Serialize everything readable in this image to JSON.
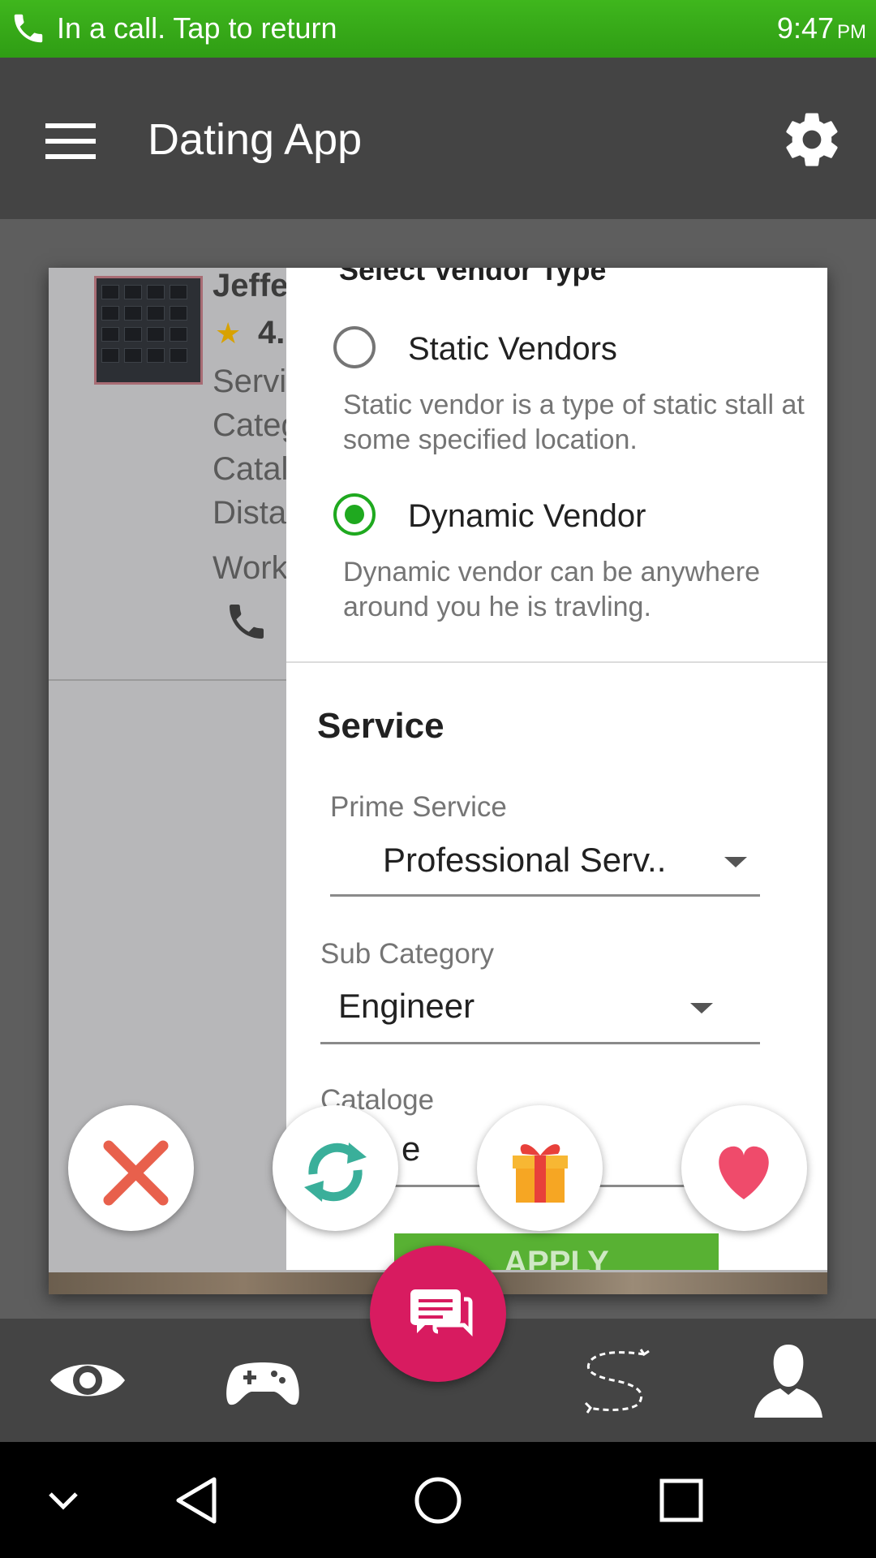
{
  "status_bar": {
    "call_text": "In a call. Tap to return",
    "time": "9:47",
    "ampm": "PM",
    "icons": [
      "phone-icon"
    ]
  },
  "app_bar": {
    "title": "Dating App",
    "icons": [
      "menu-icon",
      "gear-icon"
    ]
  },
  "card": {
    "name": "Jeffe",
    "rating": "4.",
    "labels": [
      "Servi",
      "Categ",
      "Catal",
      "Dista",
      "Work"
    ],
    "icons": [
      "star-icon",
      "phone-icon"
    ]
  },
  "dialog": {
    "section_title": "Select Vendor Type",
    "options": [
      {
        "label": "Static Vendors",
        "description": "Static vendor is a type of static stall at some specified location.",
        "selected": false
      },
      {
        "label": "Dynamic Vendor",
        "description": "Dynamic vendor can be anywhere around you he is travling.",
        "selected": true
      }
    ],
    "service": {
      "title": "Service",
      "prime_service_label": "Prime Service",
      "prime_service_value": "Professional Serv..",
      "sub_category_label": "Sub Category",
      "sub_category_value": "Engineer",
      "catalogue_label": "Cataloge",
      "catalogue_value": "e"
    },
    "apply_label": "APPLY",
    "accent_color": "#1fa91f",
    "apply_color": "#58b133"
  },
  "action_buttons": [
    "close-icon",
    "refresh-icon",
    "gift-icon",
    "heart-icon"
  ],
  "chat_button": {
    "icon": "chat-icon",
    "color": "#d81b60"
  },
  "tab_bar": {
    "icons": [
      "eye-icon",
      "gamepad-icon",
      "route-icon",
      "profile-icon"
    ]
  },
  "nav_bar": {
    "icons": [
      "collapse-icon",
      "back-icon",
      "home-icon",
      "recents-icon"
    ]
  }
}
